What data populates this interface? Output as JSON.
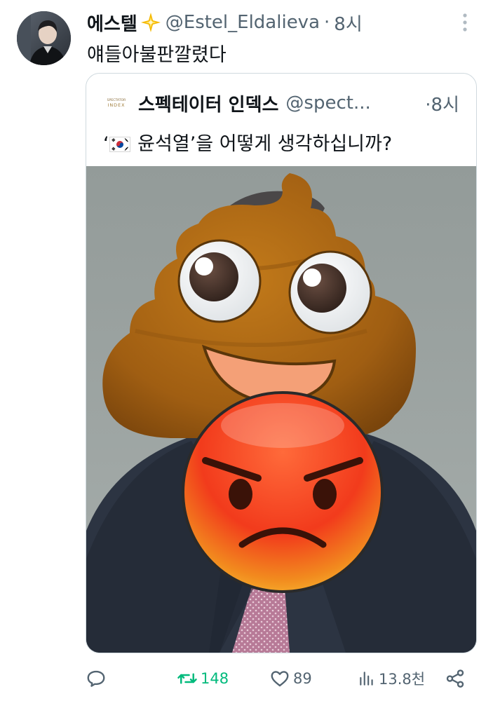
{
  "tweet": {
    "display_name": "에스텔",
    "handle": "@Estel_Eldalieva",
    "dot": "·",
    "time": "8시",
    "text": "얘들아불판깔렸다"
  },
  "quote": {
    "source_logo_text": [
      "SPECTATOR",
      "INDEX"
    ],
    "display_name": "스펙테이터 인덱스",
    "handle": "@spect...",
    "dot": "·",
    "time": "8시",
    "text": "‘🇰🇷 윤석열’을 어떻게 생각하십니까?",
    "text_open_quote": "‘",
    "text_body": " 윤석열’을 어떻게 생각하십니까?"
  },
  "actions": {
    "reply_count": "",
    "retweet_count": "148",
    "like_count": "89",
    "views_count": "13.8천"
  },
  "colors": {
    "text_primary": "#0f1419",
    "text_secondary": "#536471",
    "retweet_active": "#00ba7c",
    "border": "#cfd9de"
  },
  "icons": [
    "more-icon",
    "sparkle-icon",
    "reply-icon",
    "retweet-icon",
    "like-icon",
    "views-icon",
    "share-icon"
  ]
}
